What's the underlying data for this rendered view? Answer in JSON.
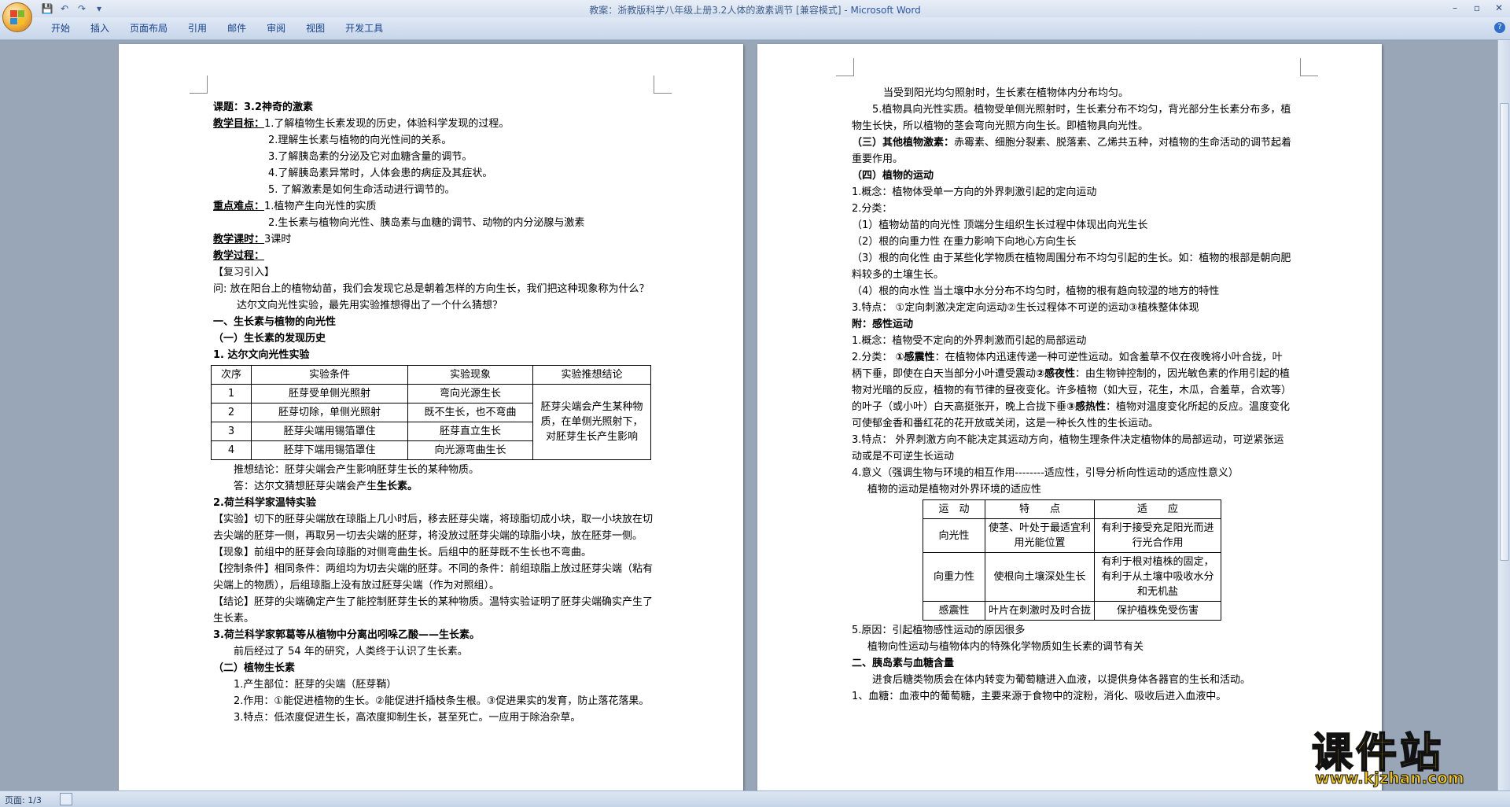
{
  "window": {
    "title": "教案：浙教版科学八年级上册3.2人体的激素调节 [兼容模式] - ",
    "app_name": "Microsoft Word",
    "minimize": "–",
    "maximize": "▫",
    "close": "✕"
  },
  "quick_access": {
    "save": "💾",
    "undo": "↶",
    "redo": "↷",
    "customize": "▾"
  },
  "ribbon": {
    "tabs": [
      "开始",
      "插入",
      "页面布局",
      "引用",
      "邮件",
      "审阅",
      "视图",
      "开发工具"
    ],
    "help": "?"
  },
  "page1": {
    "title_label": "课题：",
    "title": "3.2神奇的激素",
    "goals_label": "教学目标：",
    "goals": [
      "1.了解植物生长素发现的历史，体验科学发现的过程。",
      "2.理解生长素与植物的向光性间的关系。",
      "3.了解胰岛素的分泌及它对血糖含量的调节。",
      "4.了解胰岛素异常时，人体会患的病症及其症状。",
      "5. 了解激素是如何生命活动进行调节的。"
    ],
    "key_label": "重点难点：",
    "key_points": [
      "1.植物产生向光性的实质",
      "2.生长素与植物向光性、胰岛素与血糖的调节、动物的内分泌腺与激素"
    ],
    "hours_label": "教学课时：",
    "hours": "3课时",
    "process_label": "教学过程：",
    "review": "【复习引入】",
    "question": "问: 放在阳台上的植物幼苗，我们会发现它总是朝着怎样的方向生长，我们把这种现象称为什么？",
    "darwin_intro": "达尔文向光性实验，最先用实验推想得出了一个什么猜想？",
    "section1": "一、生长素与植物的向光性",
    "sub1": "（一）生长素的发现历史",
    "darwin_title": "1. 达尔文向光性实验",
    "table_headers": [
      "次序",
      "实验条件",
      "实验现象",
      "实验推想结论"
    ],
    "table_rows": [
      {
        "no": "1",
        "cond": "胚芽受单侧光照射",
        "result": "弯向光源生长"
      },
      {
        "no": "2",
        "cond": "胚芽切除，单侧光照射",
        "result": "既不生长，也不弯曲"
      },
      {
        "no": "3",
        "cond": "胚芽尖端用锡箔罩住",
        "result": "胚芽直立生长"
      },
      {
        "no": "4",
        "cond": "胚芽下端用锡箔罩住",
        "result": "向光源弯曲生长"
      }
    ],
    "table_conclusion": "胚芽尖端会产生某种物质，在单侧光照射下，对胚芽生长产生影响",
    "inference": "推想结论：胚芽尖端会产生影响胚芽生长的某种物质。",
    "answer_prefix": "答：达尔文猜想胚芽尖端会产生",
    "answer_bold": "生长素。",
    "went_title": "2.荷兰科学家温特实验",
    "went_experiment": "【实验】切下的胚芽尖端放在琼脂上几小时后，移去胚芽尖端，将琼脂切成小块，取一小块放在切去尖端的胚芽一侧，再取另一切去尖端的胚芽，将没放过胚芽尖端的琼脂小块，放在胚芽一侧。",
    "went_phenomenon": "【现象】前组中的胚芽会向琼脂的对侧弯曲生长。后组中的胚芽既不生长也不弯曲。",
    "went_control": "【控制条件】相同条件：两组均为切去尖端的胚芽。不同的条件：前组琼脂上放过胚芽尖端（粘有尖端上的物质），后组琼脂上没有放过胚芽尖端（作为对照组）。",
    "went_conclusion": "【结论】胚芽的尖端确定产生了能控制胚芽生长的某种物质。温特实验证明了胚芽尖端确实产生了生长素。",
    "kogl_title": "3.荷兰科学家郭葛等从植物中分离出吲哚乙酸——生长素。",
    "kogl_text": "前后经过了 54 年的研究，人类终于认识了生长素。",
    "sub2": "（二）植物生长素",
    "p_site": "1.产生部位：胚芽的尖端（胚芽鞘）",
    "p_effect": "2.作用：①能促进植物的生长。②能促进扦插枝条生根。③促进果实的发育，防止落花落果。",
    "p_feature": "3.特点：低浓度促进生长，高浓度抑制生长，甚至死亡。一应用于除治杂草。"
  },
  "page2": {
    "l1": "当受到阳光均匀照射时，生长素在植物体内分布均匀。",
    "l2": "5.植物具向光性实质。植物受单侧光照射时，生长素分布不均匀，背光部分生长素分布多，植物生长快，所以植物的茎会弯向光照方向生长。即植物具向光性。",
    "l3_bold": "（三）其他植物激素：",
    "l3": "赤霉素、细胞分裂素、脱落素、乙烯共五种，对植物的生命活动的调节起着重要作用。",
    "l4": "（四）植物的运动",
    "l5": "1.概念：植物体受单一方向的外界刺激引起的定向运动",
    "l6": "2.分类：",
    "l7": "（1）植物幼苗的向光性 顶端分生组织生长过程中体现出向光生长",
    "l8": "（2）根的向重力性 在重力影响下向地心方向生长",
    "l9": "（3）根的向化性 由于某些化学物质在植物周围分布不均匀引起的生长。如：植物的根部是朝向肥料较多的土壤生长。",
    "l10": "（4）根的向水性 当土壤中水分分布不均匀时，植物的根有趋向较湿的地方的特性",
    "l11": "3.特点： ①定向刺激决定定向运动②生长过程体不可逆的运动③植株整体体现",
    "l12": "附：感性运动",
    "l13": "1.概念：植物受不定向的外界刺激而引起的局部运动",
    "l14a": "2.分类： ",
    "l14b": "①感震性",
    "l14c": "：在植物体内迅速传递一种可逆性运动。如含羞草不仅在夜晚将小叶合拢，叶柄下垂，即使在白天当部分小叶遭受震动",
    "l14d": "②感夜性",
    "l14e": "：由生物钟控制的，因光敏色素的作用引起的植物对光暗的反应，植物的有节律的昼夜变化。许多植物（如大豆，花生，木瓜，合羞草，合欢等）的叶子（或小叶）白天高挺张开，晚上合拢下垂",
    "l14f": "③感热性",
    "l14g": "：植物对温度变化所起的反应。温度变化可使郁金香和番红花的花开放或关闭，这是一种长久性的生长运动。",
    "l15": "3.特点： 外界刺激方向不能决定其运动方向，植物生理条件决定植物体的局部运动，可逆紧张运动或是不可逆生长运动",
    "l16": "4.意义（强调生物与环境的相互作用--------适应性，引导分析向性运动的适应性意义）",
    "l17": "植物的运动是植物对外界环境的适应性",
    "table_headers": [
      "运　动",
      "特　　点",
      "适　　应"
    ],
    "table_rows": [
      {
        "m": "向光性",
        "f": "使茎、叶处于最适宜利用光能位置",
        "a": "有利于接受充足阳光而进行光合作用"
      },
      {
        "m": "向重力性",
        "f": "使根向土壤深处生长",
        "a": "有利于根对植株的固定，有利于从土壤中吸收水分和无机盐"
      },
      {
        "m": "感震性",
        "f": "叶片在刺激时及时合拢",
        "a": "保护植株免受伤害"
      }
    ],
    "l18": "5.原因：引起植物感性运动的原因很多",
    "l19": "植物向性运动与植物体内的特殊化学物质如生长素的调节有关",
    "l20": "二、胰岛素与血糖含量",
    "l21": "进食后糖类物质会在体内转变为葡萄糖进入血液，以提供身体各器官的生长和活动。",
    "l22": "1、血糖：血液中的葡萄糖，主要来源于食物中的淀粉，消化、吸收后进入血液中。"
  },
  "status": {
    "page": "页面: 1/3"
  },
  "watermark": {
    "title": "课件站",
    "url": "www.kjzhan.com"
  },
  "colors": {
    "ribbon_text": "#15428b",
    "accent": "#2b57a5",
    "watermark": "#f3c60c"
  }
}
